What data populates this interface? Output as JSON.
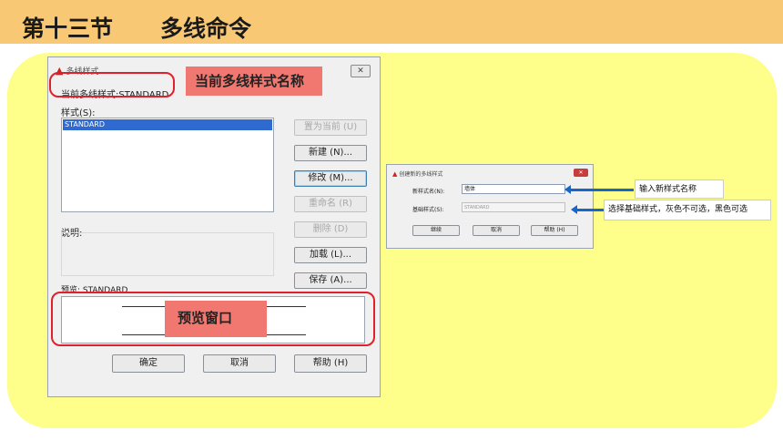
{
  "slide": {
    "section": "第十三节",
    "title": "多线命令"
  },
  "main_dialog": {
    "title": "多线样式",
    "current_style": "当前多线样式:STANDARD",
    "styles_label": "样式(S):",
    "styles": [
      "STANDARD"
    ],
    "description_label": "说明:",
    "preview_label": "预览: STANDARD",
    "buttons": {
      "set_current": "置为当前 (U)",
      "new": "新建 (N)...",
      "modify": "修改 (M)...",
      "rename": "重命名 (R)",
      "delete": "删除 (D)",
      "load": "加载 (L)...",
      "save": "保存 (A)...",
      "ok": "确定",
      "cancel": "取消",
      "help": "帮助 (H)"
    }
  },
  "annotations": {
    "current_name": "当前多线样式名称",
    "preview_window": "预览窗口",
    "new_name_hint": "输入新样式名称",
    "base_style_hint": "选择基础样式，灰色不可选，黑色可选"
  },
  "new_dialog": {
    "title": "创建新的多线样式",
    "name_label": "新样式名(N):",
    "name_value": "墙体",
    "base_label": "基础样式(S):",
    "base_value": "STANDARD",
    "buttons": {
      "continue": "继续",
      "cancel": "取消",
      "help": "帮助 (H)"
    }
  },
  "colors": {
    "title_bar": "#f9c874",
    "panel": "#fefe8a",
    "highlight_red": "#e0202a",
    "label_fill": "#f07870",
    "arrow_blue": "#1866c8"
  }
}
